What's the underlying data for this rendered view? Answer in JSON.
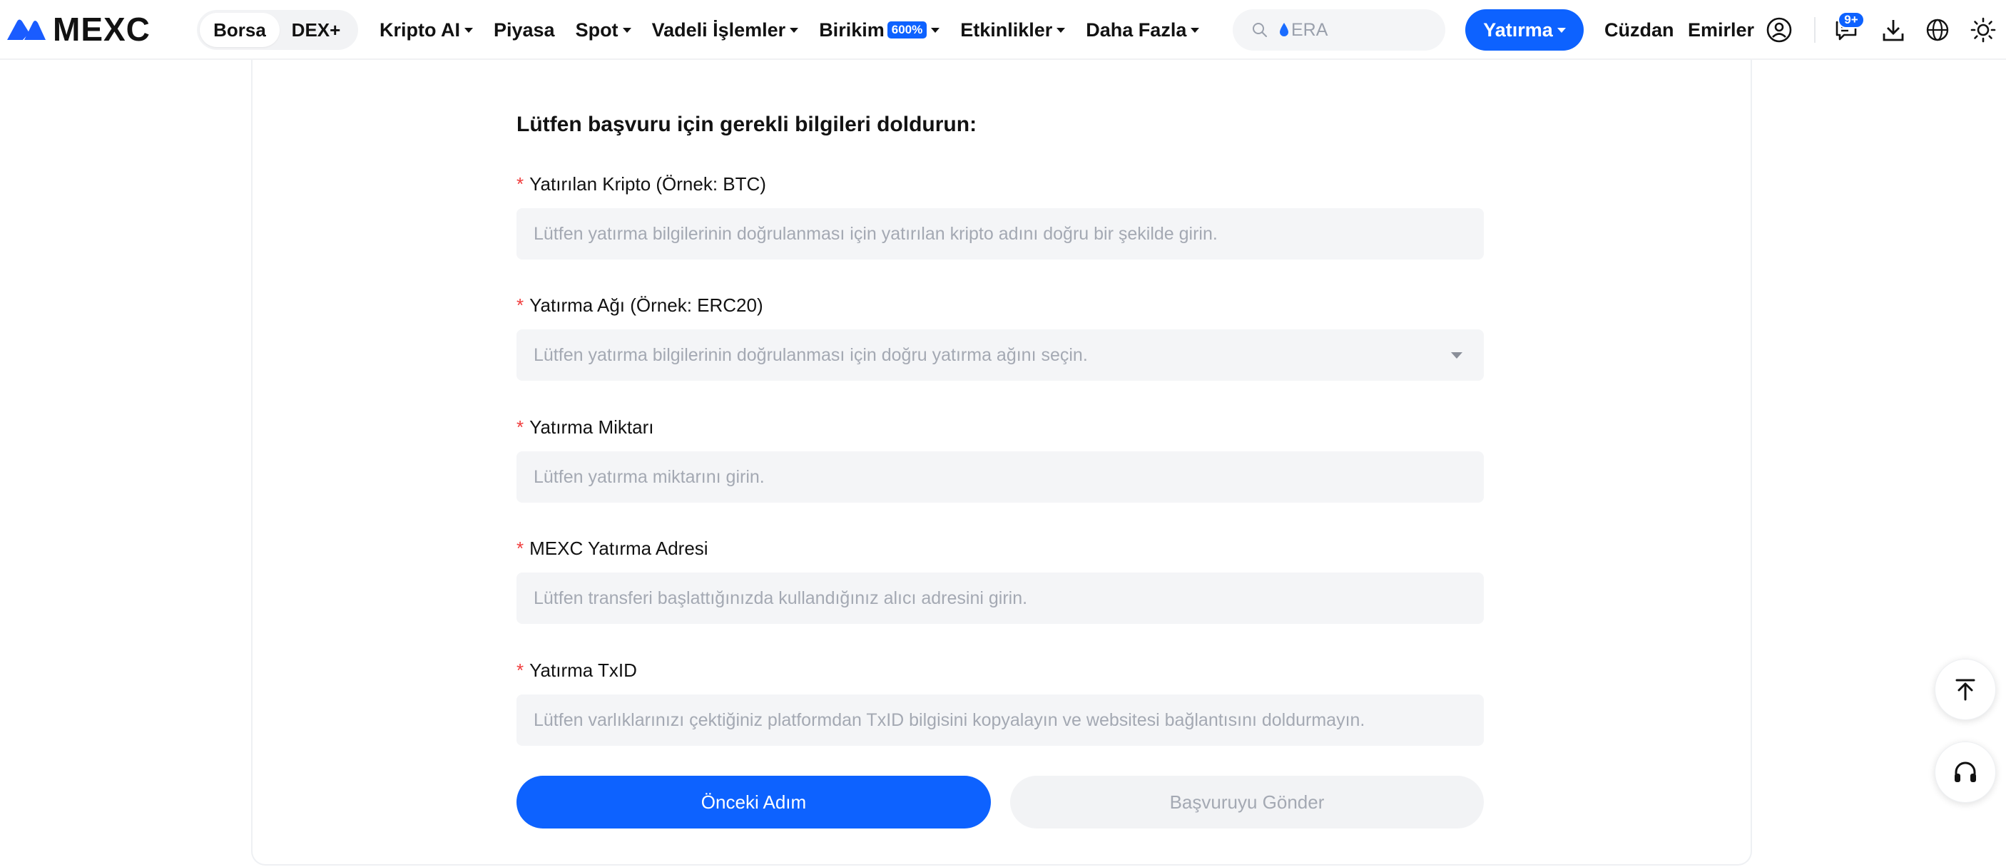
{
  "header": {
    "logo_text": "MEXC",
    "segment": [
      "Borsa",
      "DEX+"
    ],
    "nav": [
      {
        "label": "Kripto AI",
        "dropdown": true
      },
      {
        "label": "Piyasa",
        "dropdown": false
      },
      {
        "label": "Spot",
        "dropdown": true
      },
      {
        "label": "Vadeli İşlemler",
        "dropdown": true
      },
      {
        "label": "Birikim",
        "badge": "600%",
        "dropdown": true
      },
      {
        "label": "Etkinlikler",
        "dropdown": true
      },
      {
        "label": "Daha Fazla",
        "dropdown": true
      }
    ],
    "search_placeholder": "ERA",
    "deposit_label": "Yatırma",
    "wallet_label": "Cüzdan",
    "orders_label": "Emirler",
    "notification_count": "9+"
  },
  "form": {
    "title": "Lütfen başvuru için gerekli bilgileri doldurun:",
    "fields": [
      {
        "label": "Yatırılan Kripto (Örnek: BTC)",
        "placeholder": "Lütfen yatırma bilgilerinin doğrulanması için yatırılan kripto adını doğru bir şekilde girin.",
        "type": "input"
      },
      {
        "label": "Yatırma Ağı (Örnek: ERC20)",
        "placeholder": "Lütfen yatırma bilgilerinin doğrulanması için doğru yatırma ağını seçin.",
        "type": "select"
      },
      {
        "label": "Yatırma Miktarı",
        "placeholder": "Lütfen yatırma miktarını girin.",
        "type": "input"
      },
      {
        "label": "MEXC Yatırma Adresi",
        "placeholder": "Lütfen transferi başlattığınızda kullandığınız alıcı adresini girin.",
        "type": "input"
      },
      {
        "label": "Yatırma TxID",
        "placeholder": "Lütfen varlıklarınızı çektiğiniz platformdan TxID bilgisini kopyalayın ve websitesi bağlantısını doldurmayın.",
        "type": "input"
      }
    ],
    "required_mark": "*",
    "prev_button": "Önceki Adım",
    "submit_button": "Başvuruyu Gönder"
  },
  "colors": {
    "accent": "#0d62ff",
    "required": "#f03d3d",
    "field_bg": "#f4f5f7",
    "placeholder": "#a4a9b3"
  },
  "icons": [
    "mexc-logo-icon",
    "search-icon",
    "drop-icon",
    "user-icon",
    "message-icon",
    "download-icon",
    "globe-icon",
    "sun-icon",
    "back-to-top-icon",
    "headset-icon"
  ]
}
